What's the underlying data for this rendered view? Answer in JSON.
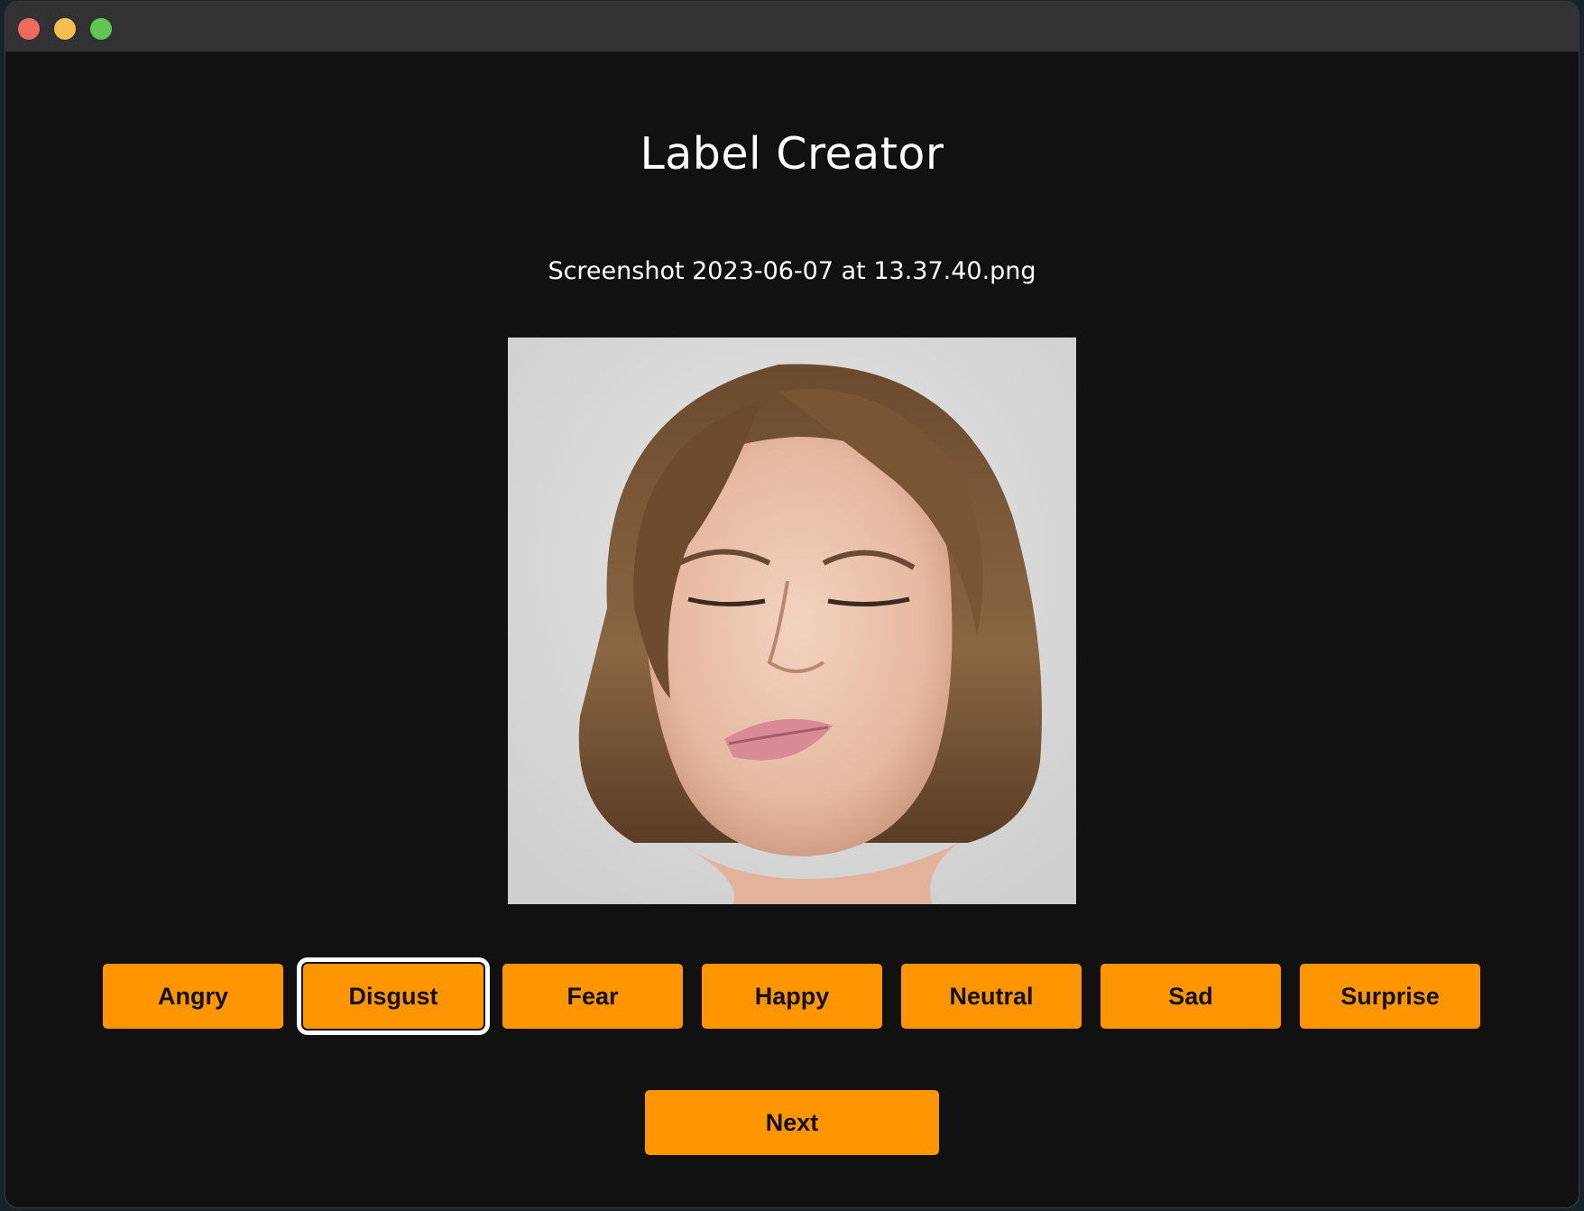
{
  "window": {
    "title_text": "Label Creator",
    "filename": "Screenshot 2023-06-07 at 13.37.40.png"
  },
  "labels": [
    {
      "text": "Angry",
      "selected": false
    },
    {
      "text": "Disgust",
      "selected": true
    },
    {
      "text": "Fear",
      "selected": false
    },
    {
      "text": "Happy",
      "selected": false
    },
    {
      "text": "Neutral",
      "selected": false
    },
    {
      "text": "Sad",
      "selected": false
    },
    {
      "text": "Surprise",
      "selected": false
    }
  ],
  "next_label": "Next",
  "colors": {
    "accent": "#ff9500",
    "background": "#111111",
    "titlebar": "#323234",
    "selected_outline": "#ffffff"
  }
}
